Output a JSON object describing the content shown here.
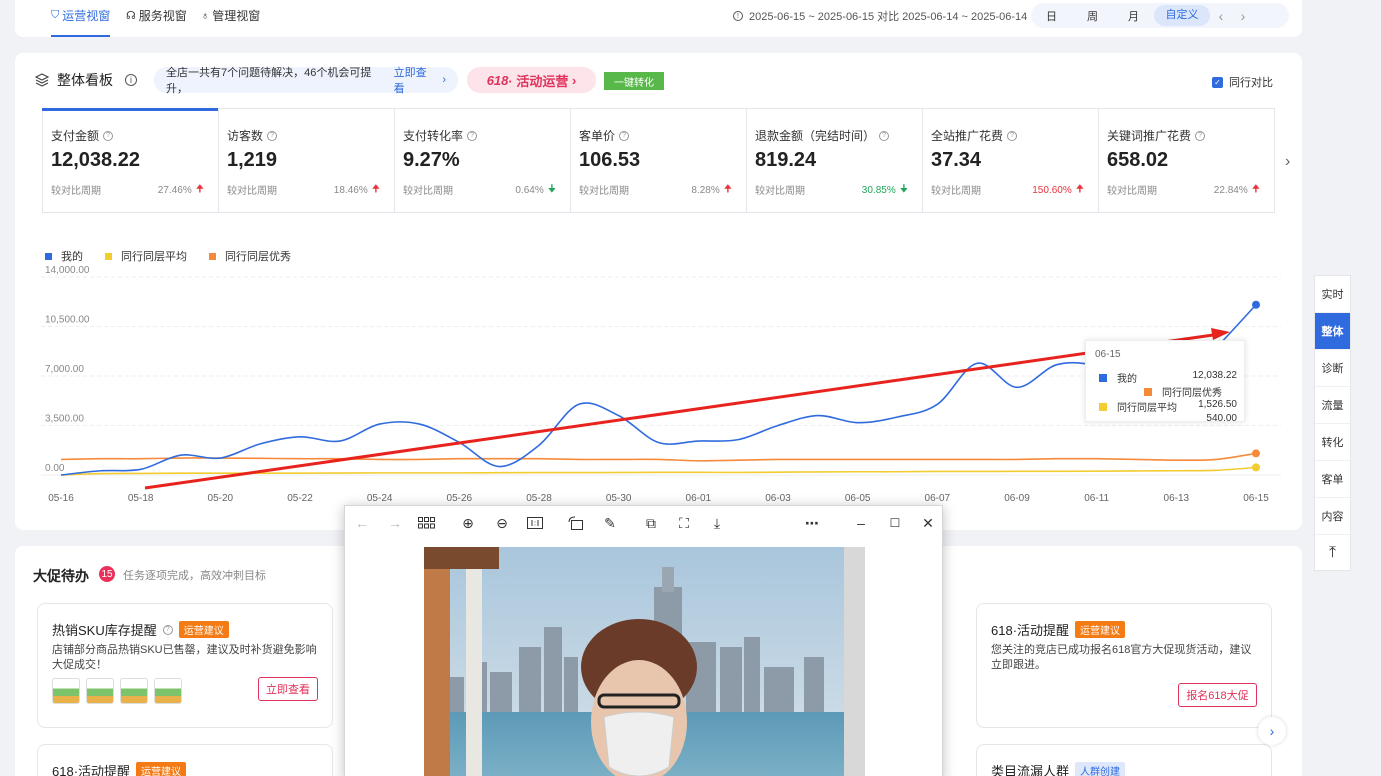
{
  "topnav": {
    "tabs": [
      {
        "label": "运营视窗",
        "active": true
      },
      {
        "label": "服务视窗",
        "active": false
      },
      {
        "label": "管理视窗",
        "active": false
      }
    ],
    "date_range": "2025-06-15 ~ 2025-06-15 对比 2025-06-14 ~ 2025-06-14",
    "periods": [
      "日",
      "周",
      "月",
      "自定义"
    ],
    "selected_period": "自定义"
  },
  "board": {
    "title": "整体看板",
    "issue_text": "全店一共有7个问题待解决，46个机会可提升，",
    "issue_link": "立即查看",
    "activity_num": "618",
    "activity_label": "· 活动运营",
    "convert_button": "一键转化",
    "peer_compare": "同行对比",
    "compare_label": "较对比周期",
    "metrics": [
      {
        "label": "支付金额",
        "value": "12,038.22",
        "pct": "27.46%",
        "dir": "up"
      },
      {
        "label": "访客数",
        "value": "1,219",
        "pct": "18.46%",
        "dir": "up"
      },
      {
        "label": "支付转化率",
        "value": "9.27%",
        "pct": "0.64%",
        "dir": "down"
      },
      {
        "label": "客单价",
        "value": "106.53",
        "pct": "8.28%",
        "dir": "up"
      },
      {
        "label": "退款金额（完结时间）",
        "value": "819.24",
        "pct": "30.85%",
        "dir": "down"
      },
      {
        "label": "全站推广花费",
        "value": "37.34",
        "pct": "150.60%",
        "dir": "up"
      },
      {
        "label": "关键词推广花费",
        "value": "658.02",
        "pct": "22.84%",
        "dir": "up"
      }
    ]
  },
  "chart_data": {
    "type": "line",
    "x": [
      "05-16",
      "05-17",
      "05-18",
      "05-19",
      "05-20",
      "05-21",
      "05-22",
      "05-23",
      "05-24",
      "05-25",
      "05-26",
      "05-27",
      "05-28",
      "05-29",
      "05-30",
      "05-31",
      "06-01",
      "06-02",
      "06-03",
      "06-04",
      "06-05",
      "06-06",
      "06-07",
      "06-08",
      "06-09",
      "06-10",
      "06-11",
      "06-12",
      "06-13",
      "06-14",
      "06-15"
    ],
    "x_tick_labels": [
      "05-16",
      "05-18",
      "05-20",
      "05-22",
      "05-24",
      "05-26",
      "05-28",
      "05-30",
      "06-01",
      "06-03",
      "06-05",
      "06-07",
      "06-09",
      "06-11",
      "06-13",
      "06-15"
    ],
    "y_tick_labels": [
      "0.00",
      "3,500.00",
      "7,000.00",
      "10,500.00",
      "14,000.00"
    ],
    "ylim": [
      0,
      14000
    ],
    "series": [
      {
        "name": "我的",
        "color": "#2f6bde",
        "values": [
          0,
          300,
          400,
          1400,
          1200,
          2200,
          2700,
          2400,
          3600,
          3600,
          2300,
          600,
          2100,
          5000,
          4200,
          2300,
          2400,
          2500,
          3500,
          4200,
          3700,
          4100,
          5000,
          7900,
          6200,
          7800,
          7700,
          6300,
          6300,
          9000,
          12038.22
        ]
      },
      {
        "name": "同行同层平均",
        "color": "#f2cc30",
        "values": [
          0,
          100,
          110,
          130,
          130,
          130,
          130,
          140,
          150,
          150,
          150,
          160,
          170,
          170,
          180,
          190,
          190,
          180,
          200,
          220,
          230,
          230,
          250,
          250,
          260,
          260,
          270,
          290,
          300,
          330,
          540
        ]
      },
      {
        "name": "同行同层优秀",
        "color": "#f58a3a",
        "values": [
          1100,
          1150,
          1150,
          1200,
          1200,
          1180,
          1150,
          1150,
          1100,
          1100,
          1150,
          1150,
          1150,
          1100,
          1100,
          1100,
          1000,
          1050,
          1100,
          1100,
          1100,
          1100,
          1100,
          1100,
          1100,
          1150,
          1150,
          1100,
          1050,
          1100,
          1526.5
        ]
      }
    ],
    "tooltip": {
      "date": "06-15",
      "rows": [
        {
          "name": "我的",
          "value": "12,038.22"
        },
        {
          "name": "同行同层优秀",
          "value": ""
        },
        {
          "name": "同行同层平均",
          "value": "1,526.50"
        },
        {
          "name": "",
          "value": "540.00"
        }
      ]
    },
    "grid": true,
    "legend": "top-left"
  },
  "rightbar": [
    "实时",
    "整体",
    "诊断",
    "流量",
    "转化",
    "客单",
    "内容",
    "↑"
  ],
  "rightbar_selected": "整体",
  "promo": {
    "title": "大促待办",
    "count": "15",
    "subtitle": "任务逐项完成，高效冲刺目标",
    "tasks": [
      {
        "title": "热销SKU库存提醒",
        "tag": "运营建议",
        "desc": "店铺部分商品热销SKU已售罄，建议及时补货避免影响大促成交！",
        "button": "立即查看"
      },
      {
        "title": "618·活动提醒",
        "tag": "运营建议",
        "desc": "您关注的竞店已成功报名618官方大促现货活动，建议立即跟进。",
        "button": "报名618大促"
      },
      {
        "title": "618·活动提醒",
        "tag": "运营建议"
      },
      {
        "title": "类目流漏人群",
        "tag": "人群创建"
      }
    ]
  }
}
